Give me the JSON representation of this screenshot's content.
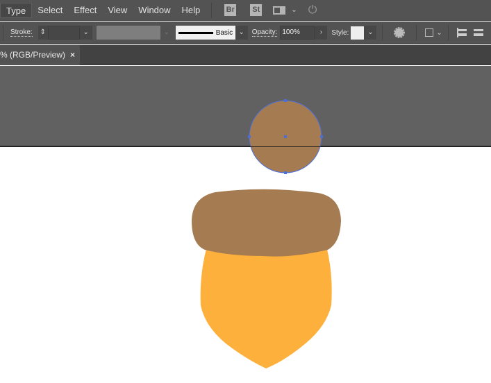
{
  "menubar": {
    "items": [
      "Type",
      "Select",
      "Effect",
      "View",
      "Window",
      "Help"
    ],
    "bridge": "Br",
    "stock": "St"
  },
  "controlbar": {
    "stroke_label": "Stroke:",
    "stroke_style": "Basic",
    "opacity_label": "Opacity:",
    "opacity_value": "100%",
    "style_label": "Style:"
  },
  "document_tab": {
    "title": "% (RGB/Preview)",
    "close": "×"
  },
  "colors": {
    "acorn_cap": "#a57c52",
    "acorn_body": "#fdb03c",
    "selection": "#4a6ee0",
    "pasteboard": "#616161"
  }
}
